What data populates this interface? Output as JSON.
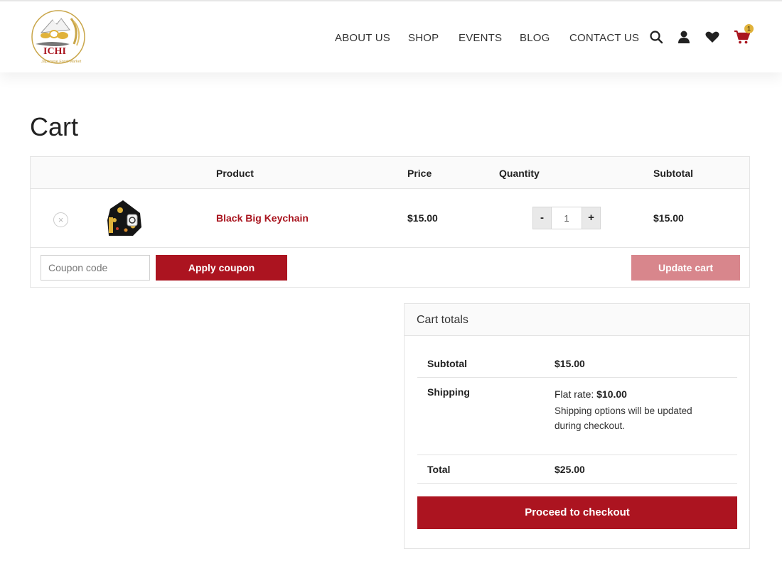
{
  "header": {
    "logo_text": "ICHI",
    "logo_subtext": "Japanese Food Market",
    "nav": [
      "ABOUT US",
      "SHOP",
      "EVENTS",
      "BLOG",
      "CONTACT US"
    ],
    "icons": [
      "search-icon",
      "account-icon",
      "wishlist-icon",
      "cart-icon"
    ],
    "cart_count": "1"
  },
  "page": {
    "title": "Cart"
  },
  "cart": {
    "columns": {
      "product": "Product",
      "price": "Price",
      "quantity": "Quantity",
      "subtotal": "Subtotal"
    },
    "items": [
      {
        "name": "Black Big Keychain",
        "price": "$15.00",
        "quantity": "1",
        "subtotal": "$15.00"
      }
    ],
    "minus_label": "-",
    "plus_label": "+",
    "remove_label": "×",
    "coupon_placeholder": "Coupon code",
    "apply_coupon_label": "Apply coupon",
    "update_cart_label": "Update cart"
  },
  "totals": {
    "title": "Cart totals",
    "subtotal_label": "Subtotal",
    "subtotal_value": "$15.00",
    "shipping_label": "Shipping",
    "shipping_prefix": "Flat rate: ",
    "shipping_amount": "$10.00",
    "shipping_note": "Shipping options will be updated during checkout.",
    "total_label": "Total",
    "total_value": "$25.00",
    "checkout_label": "Proceed to checkout"
  },
  "colors": {
    "brand_red": "#ac1420",
    "update_disabled": "#d8868c",
    "badge_gold": "#e0b23a"
  }
}
